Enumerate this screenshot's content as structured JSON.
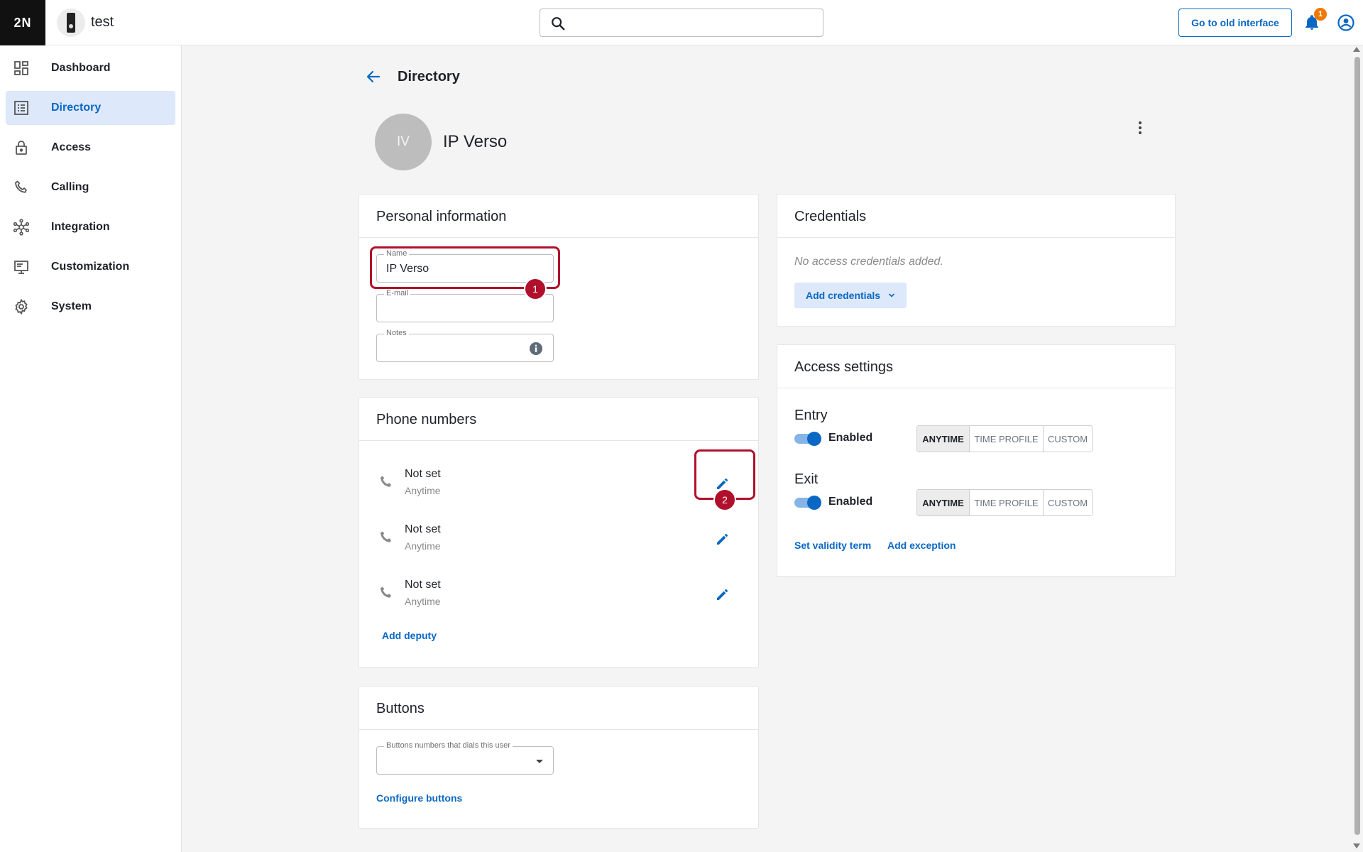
{
  "app": {
    "logo_text": "2N",
    "device_name": "test",
    "old_interface_label": "Go to old interface",
    "notification_count": "1",
    "accent_color": "#0a68c4",
    "annotation_color": "#b0102b"
  },
  "search": {
    "placeholder": "",
    "icon": "search-icon"
  },
  "sidebar": {
    "items": [
      {
        "label": "Dashboard",
        "icon": "dashboard-icon",
        "active": false
      },
      {
        "label": "Directory",
        "icon": "directory-icon",
        "active": true
      },
      {
        "label": "Access",
        "icon": "lock-icon",
        "active": false
      },
      {
        "label": "Calling",
        "icon": "phone-icon",
        "active": false
      },
      {
        "label": "Integration",
        "icon": "integration-icon",
        "active": false
      },
      {
        "label": "Customization",
        "icon": "monitor-icon",
        "active": false
      },
      {
        "label": "System",
        "icon": "gear-icon",
        "active": false
      }
    ]
  },
  "header": {
    "page_title": "Directory",
    "avatar_initials": "IV",
    "user_name": "IP Verso"
  },
  "personal": {
    "title": "Personal information",
    "name_label": "Name",
    "name_value": "IP Verso",
    "email_label": "E-mail",
    "email_value": "",
    "notes_label": "Notes",
    "notes_value": ""
  },
  "annotations": {
    "badge1": "1",
    "badge2": "2"
  },
  "phones": {
    "title": "Phone numbers",
    "rows": [
      {
        "number": "Not set",
        "time": "Anytime"
      },
      {
        "number": "Not set",
        "time": "Anytime"
      },
      {
        "number": "Not set",
        "time": "Anytime"
      }
    ],
    "add_deputy": "Add deputy"
  },
  "buttons": {
    "title": "Buttons",
    "select_label": "Buttons numbers that dials this user",
    "select_value": "",
    "configure": "Configure buttons"
  },
  "credentials": {
    "title": "Credentials",
    "empty_text": "No access credentials added.",
    "add_label": "Add credentials"
  },
  "access": {
    "title": "Access settings",
    "entry": {
      "label": "Entry",
      "toggle_label": "Enabled",
      "enabled": true,
      "options": [
        "ANYTIME",
        "TIME PROFILE",
        "CUSTOM"
      ],
      "selected": "ANYTIME"
    },
    "exit": {
      "label": "Exit",
      "toggle_label": "Enabled",
      "enabled": true,
      "options": [
        "ANYTIME",
        "TIME PROFILE",
        "CUSTOM"
      ],
      "selected": "ANYTIME"
    },
    "set_validity": "Set validity term",
    "add_exception": "Add exception"
  }
}
